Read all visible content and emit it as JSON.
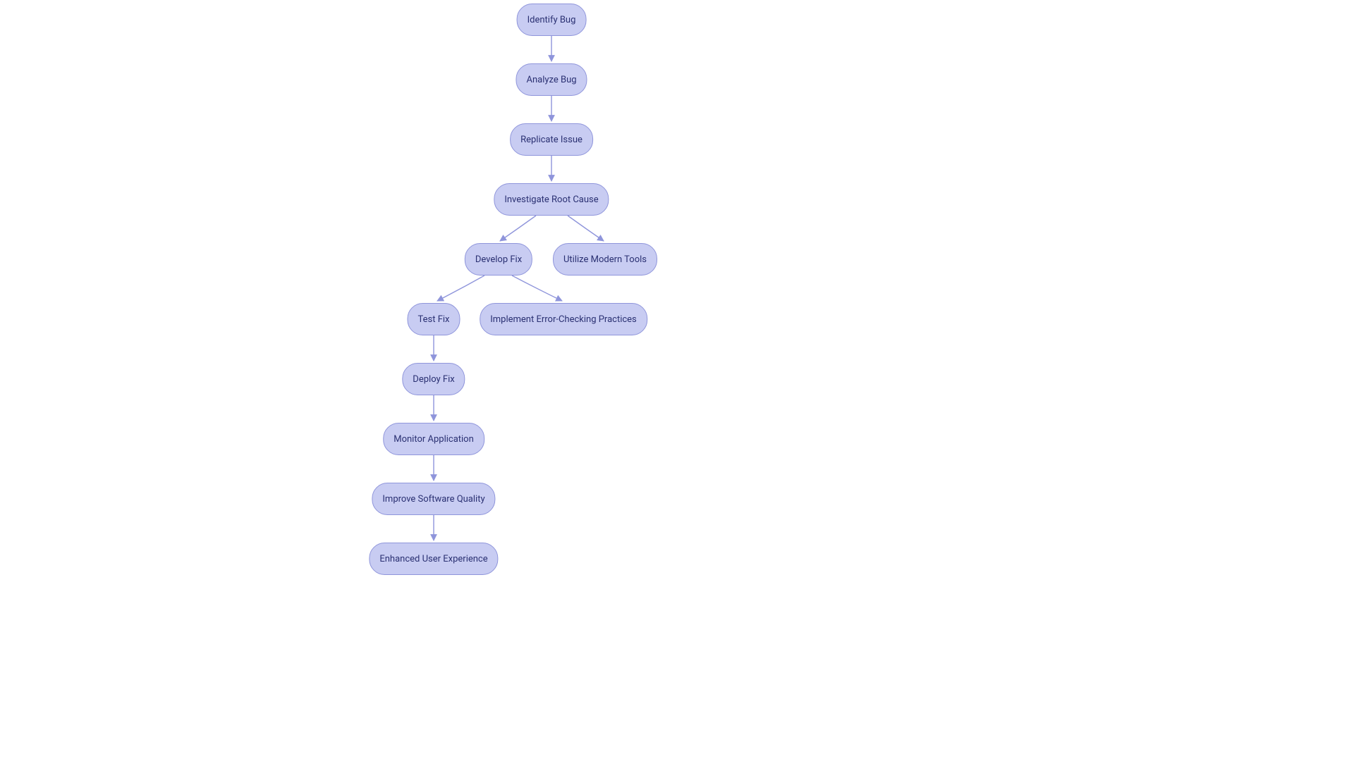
{
  "colors": {
    "node_fill": "#c8ccf2",
    "node_border": "#8f95db",
    "node_text": "#2a3072",
    "edge": "#8f95db"
  },
  "nodes": {
    "n1": "Identify Bug",
    "n2": "Analyze Bug",
    "n3": "Replicate Issue",
    "n4": "Investigate Root Cause",
    "n5": "Develop Fix",
    "n6": "Utilize Modern Tools",
    "n7": "Test Fix",
    "n8": "Implement Error-Checking Practices",
    "n9": "Deploy Fix",
    "n10": "Monitor Application",
    "n11": "Improve Software Quality",
    "n12": "Enhanced User Experience"
  },
  "edges": [
    [
      "n1",
      "n2"
    ],
    [
      "n2",
      "n3"
    ],
    [
      "n3",
      "n4"
    ],
    [
      "n4",
      "n5"
    ],
    [
      "n4",
      "n6"
    ],
    [
      "n5",
      "n7"
    ],
    [
      "n5",
      "n8"
    ],
    [
      "n7",
      "n9"
    ],
    [
      "n9",
      "n10"
    ],
    [
      "n10",
      "n11"
    ],
    [
      "n11",
      "n12"
    ]
  ]
}
